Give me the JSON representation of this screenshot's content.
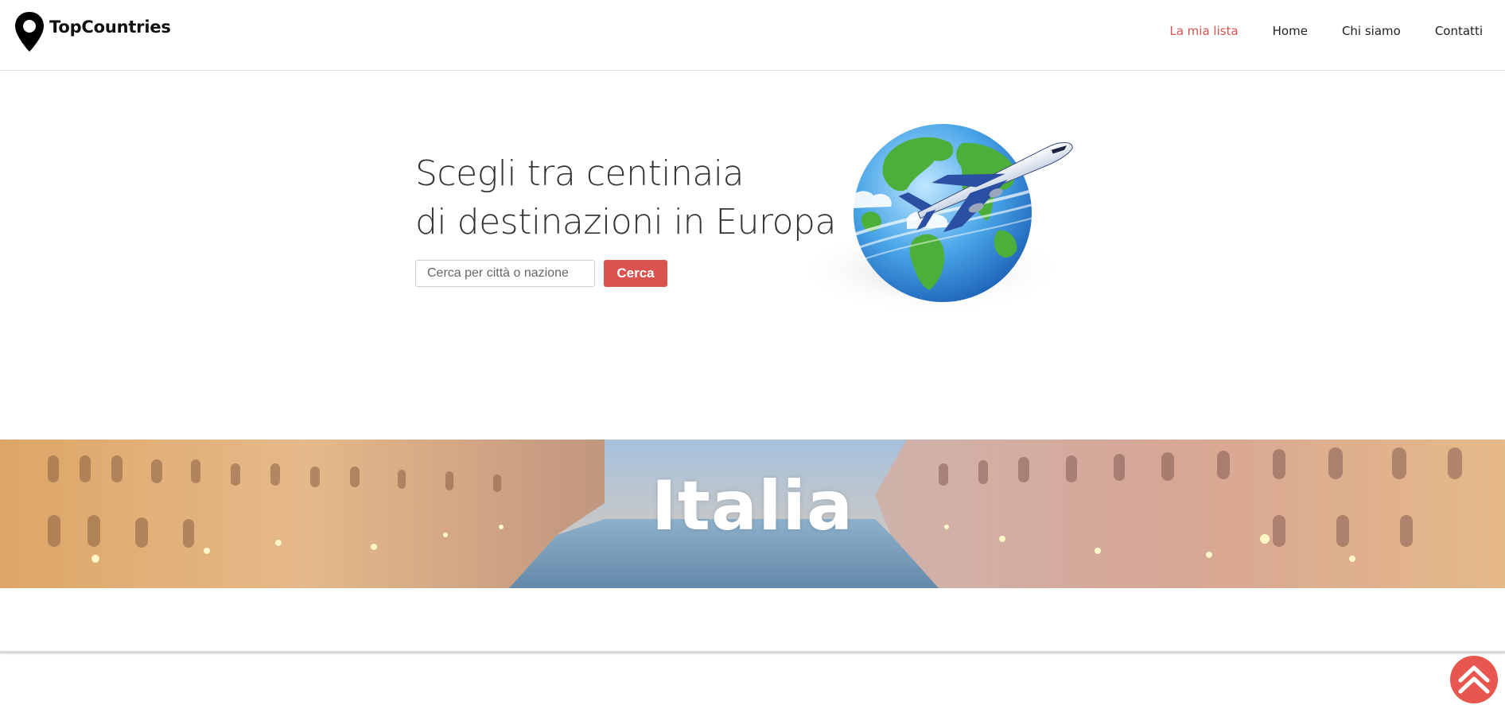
{
  "brand": {
    "name": "TopCountries",
    "icon": "map-pin-icon"
  },
  "nav": {
    "items": [
      {
        "label": "La mia lista",
        "active": true
      },
      {
        "label": "Home",
        "active": false
      },
      {
        "label": "Chi siamo",
        "active": false
      },
      {
        "label": "Contatti",
        "active": false
      }
    ]
  },
  "hero": {
    "line1": "Scegli tra centinaia",
    "line2": "di destinazioni in Europa",
    "search": {
      "placeholder": "Cerca per città o nazione",
      "value": ""
    },
    "search_button": "Cerca",
    "illustration": "globe-airplane-icon"
  },
  "banner": {
    "title": "Italia"
  },
  "scroll_top": {
    "icon": "double-chevron-up-icon"
  },
  "colors": {
    "accent": "#d9534f",
    "text": "#222222",
    "scroll_button": "#e8574f"
  }
}
